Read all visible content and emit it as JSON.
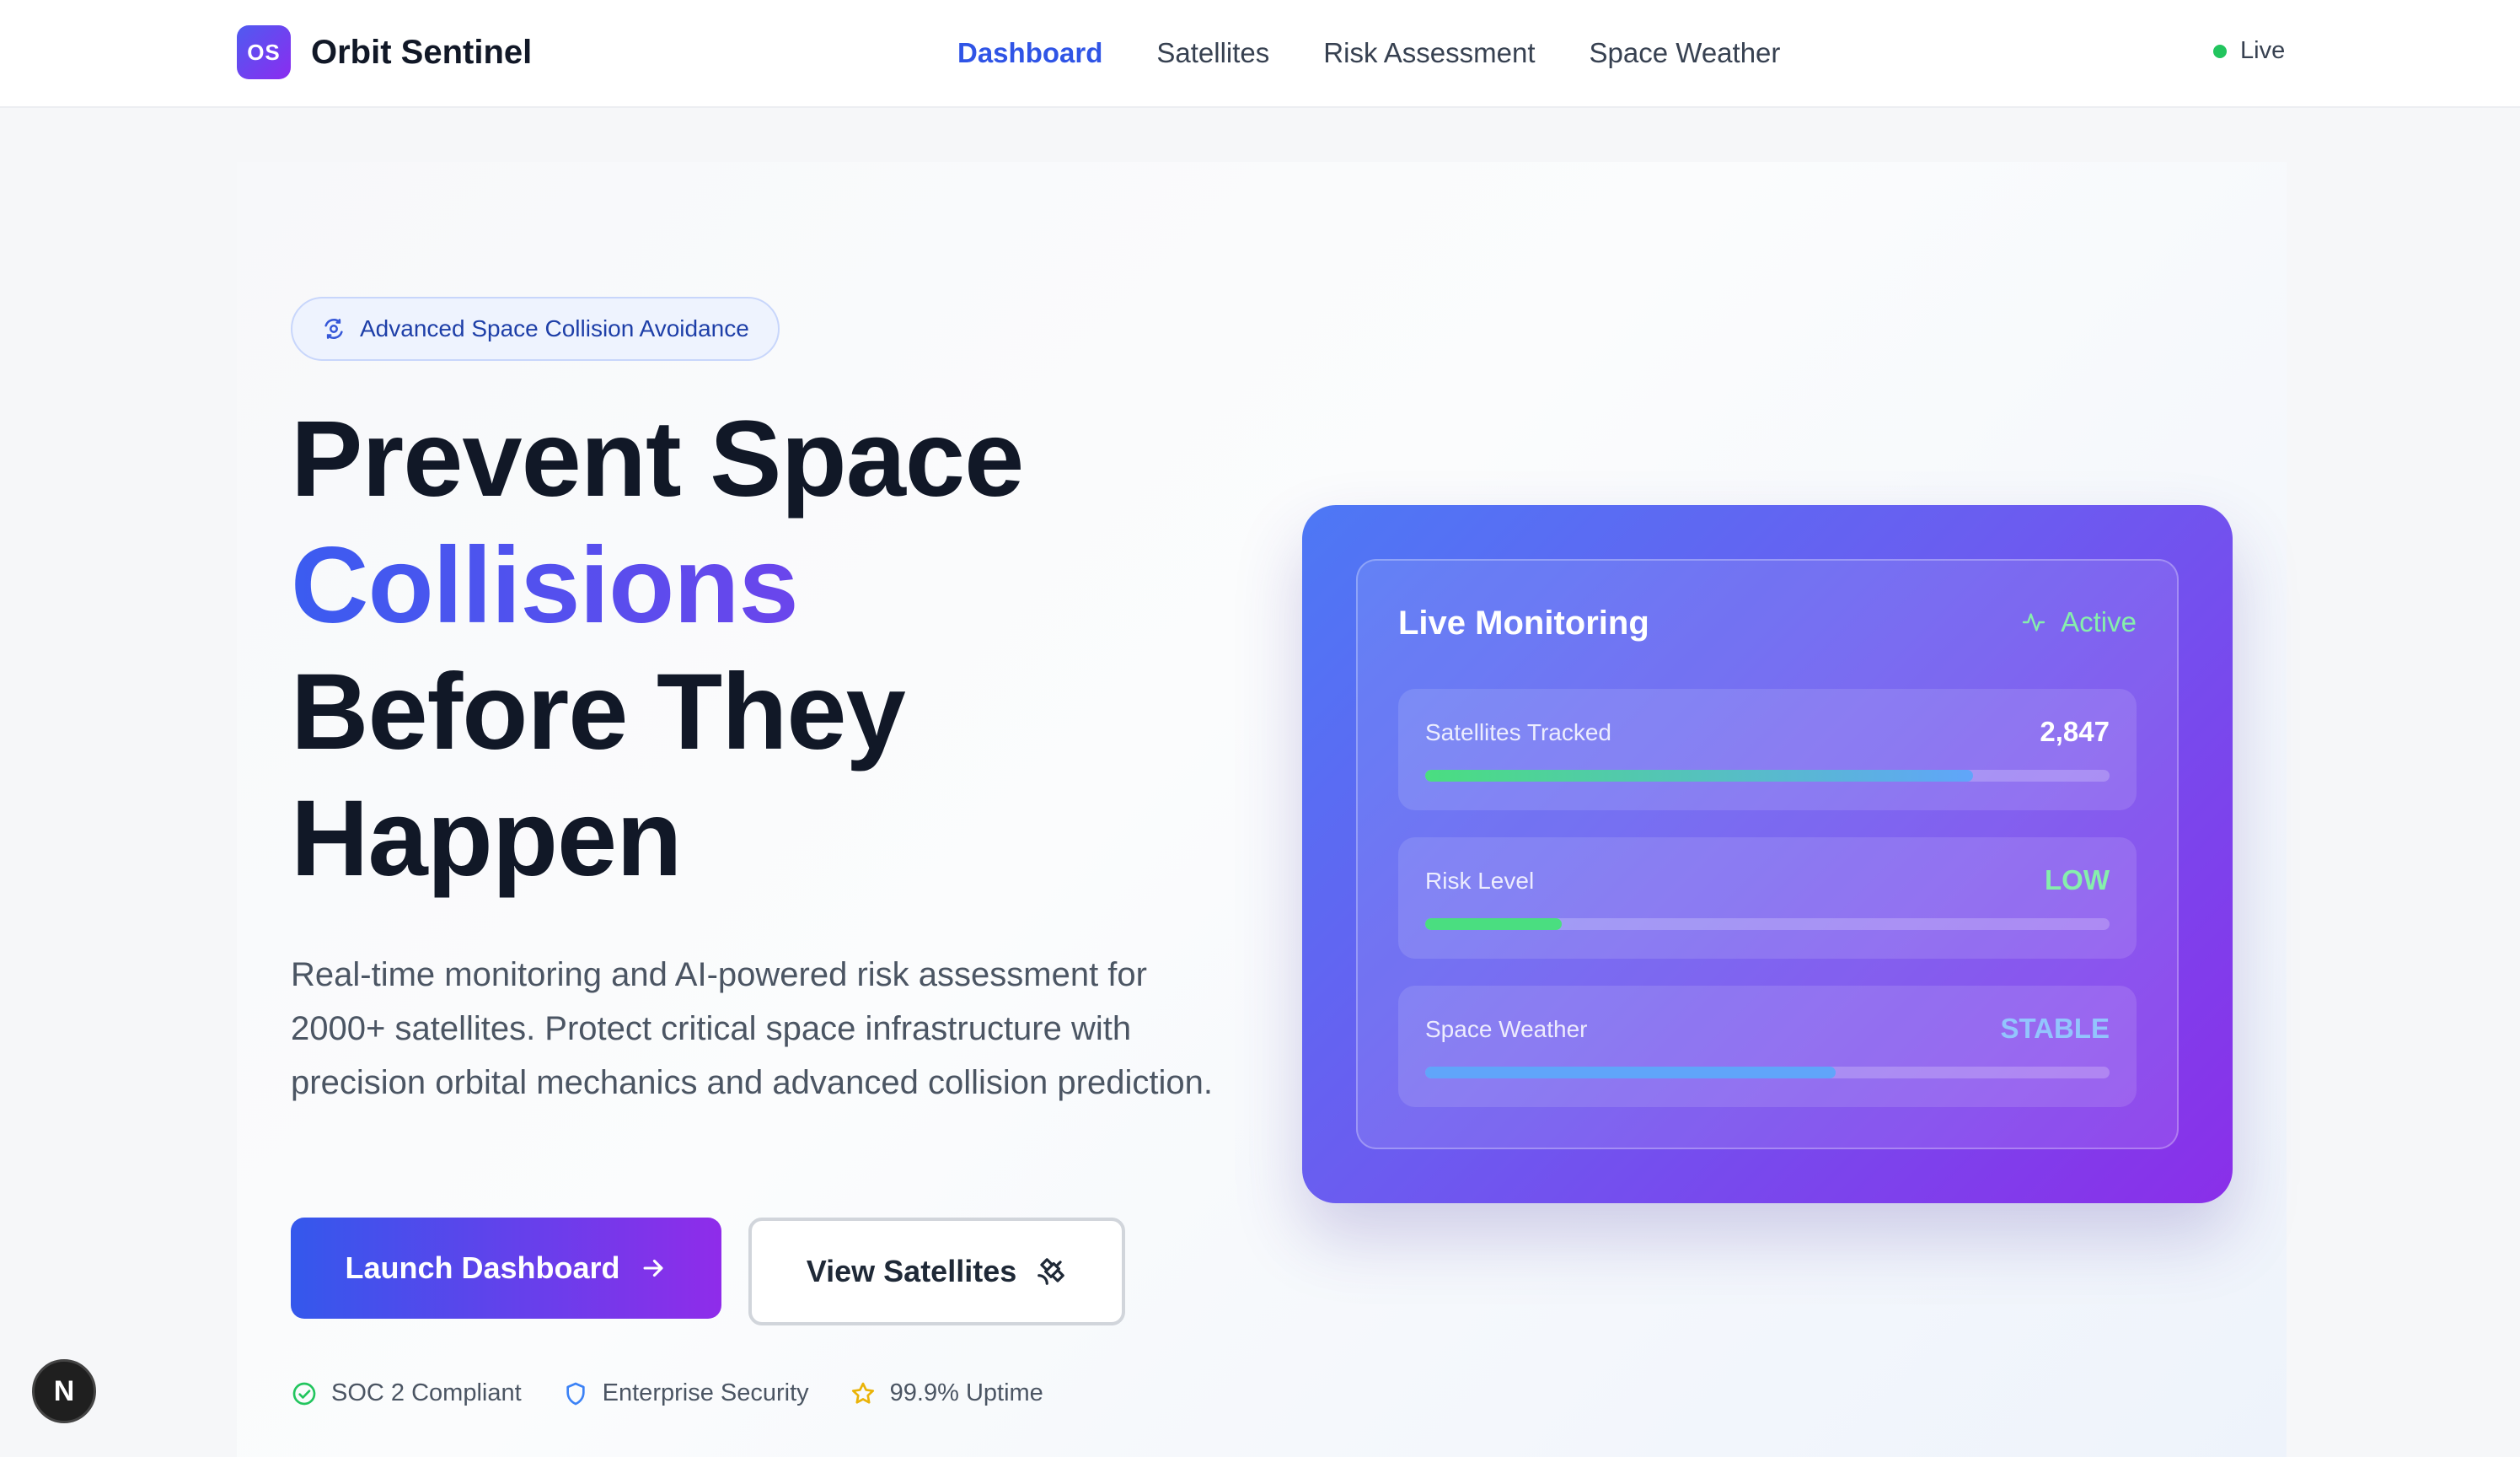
{
  "header": {
    "logo_text": "OS",
    "brand_name": "Orbit Sentinel",
    "nav": [
      {
        "label": "Dashboard",
        "active": true
      },
      {
        "label": "Satellites",
        "active": false
      },
      {
        "label": "Risk Assessment",
        "active": false
      },
      {
        "label": "Space Weather",
        "active": false
      }
    ],
    "live_label": "Live"
  },
  "hero": {
    "badge": "Advanced Space Collision Avoidance",
    "headline_line1": "Prevent Space",
    "headline_line2": "Collisions",
    "headline_line3": "Before They",
    "headline_line4": "Happen",
    "description": "Real-time monitoring and AI-powered risk assessment for 2000+ satellites. Protect critical space infrastructure with precision orbital mechanics and advanced collision prediction.",
    "primary_button": "Launch Dashboard",
    "secondary_button": "View Satellites",
    "trust": [
      {
        "label": "SOC 2 Compliant",
        "icon": "check-circle-icon"
      },
      {
        "label": "Enterprise Security",
        "icon": "shield-icon"
      },
      {
        "label": "99.9% Uptime",
        "icon": "star-icon"
      }
    ]
  },
  "monitor": {
    "title": "Live Monitoring",
    "status": "Active",
    "metrics": [
      {
        "label": "Satellites Tracked",
        "value": "2,847",
        "value_color": "#ffffff",
        "progress": 0.8,
        "fill": "linear-gradient(90deg, #4ade80 0%, #60a5fa 100%)"
      },
      {
        "label": "Risk Level",
        "value": "LOW",
        "value_color": "#86efac",
        "progress": 0.2,
        "fill": "#4ade80"
      },
      {
        "label": "Space Weather",
        "value": "STABLE",
        "value_color": "#93c5fd",
        "progress": 0.6,
        "fill": "#60a5fa"
      }
    ]
  },
  "floating_badge": "N",
  "colors": {
    "accent": "#2f54e6",
    "gradient_start": "#3b5cf0",
    "gradient_end": "#9332e8",
    "live": "#22c55e"
  }
}
